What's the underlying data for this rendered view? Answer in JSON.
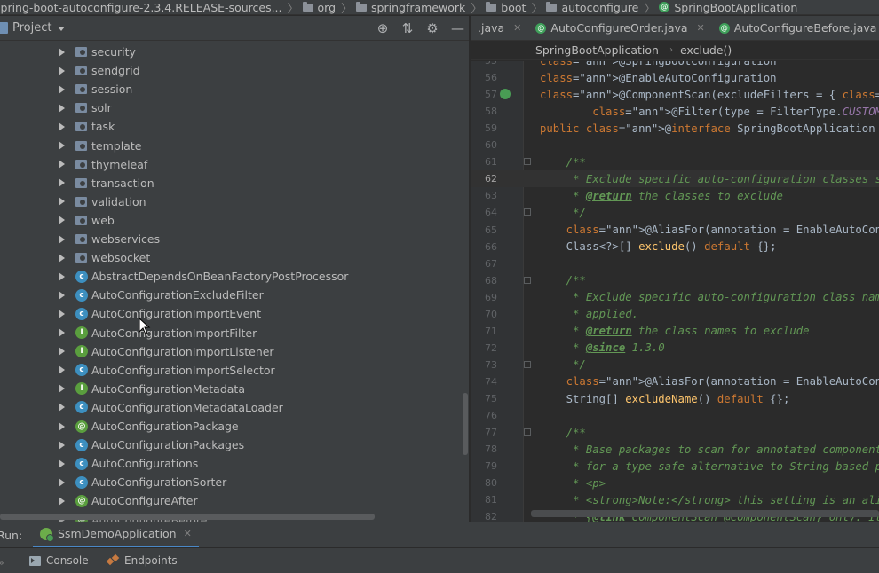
{
  "breadcrumbs": [
    {
      "label": "spring-boot-autoconfigure-2.3.4.RELEASE-sources...",
      "icon": "none"
    },
    {
      "label": "org",
      "icon": "folder-icon"
    },
    {
      "label": "springframework",
      "icon": "folder-icon"
    },
    {
      "label": "boot",
      "icon": "folder-icon"
    },
    {
      "label": "autoconfigure",
      "icon": "folder-icon"
    },
    {
      "label": "SpringBootApplication",
      "icon": "annotation-icon"
    }
  ],
  "project_panel": {
    "title": "Project",
    "tools": [
      "locate-icon",
      "collapse-icon",
      "gear-icon",
      "minimize-icon"
    ],
    "tree": [
      {
        "label": "security",
        "kind": "package",
        "icon": "package-icon"
      },
      {
        "label": "sendgrid",
        "kind": "package",
        "icon": "package-icon"
      },
      {
        "label": "session",
        "kind": "package",
        "icon": "package-icon"
      },
      {
        "label": "solr",
        "kind": "package",
        "icon": "package-icon"
      },
      {
        "label": "task",
        "kind": "package",
        "icon": "package-icon"
      },
      {
        "label": "template",
        "kind": "package",
        "icon": "package-icon"
      },
      {
        "label": "thymeleaf",
        "kind": "package",
        "icon": "package-icon"
      },
      {
        "label": "transaction",
        "kind": "package",
        "icon": "package-icon"
      },
      {
        "label": "validation",
        "kind": "package",
        "icon": "package-icon"
      },
      {
        "label": "web",
        "kind": "package",
        "icon": "package-icon"
      },
      {
        "label": "webservices",
        "kind": "package",
        "icon": "package-icon"
      },
      {
        "label": "websocket",
        "kind": "package",
        "icon": "package-icon"
      },
      {
        "label": "AbstractDependsOnBeanFactoryPostProcessor",
        "kind": "abstract-class",
        "icon": "abstract-class-icon"
      },
      {
        "label": "AutoConfigurationExcludeFilter",
        "kind": "class",
        "icon": "class-icon"
      },
      {
        "label": "AutoConfigurationImportEvent",
        "kind": "class",
        "icon": "class-icon"
      },
      {
        "label": "AutoConfigurationImportFilter",
        "kind": "interface",
        "icon": "interface-icon"
      },
      {
        "label": "AutoConfigurationImportListener",
        "kind": "interface",
        "icon": "interface-icon"
      },
      {
        "label": "AutoConfigurationImportSelector",
        "kind": "class",
        "icon": "class-icon"
      },
      {
        "label": "AutoConfigurationMetadata",
        "kind": "interface",
        "icon": "interface-icon"
      },
      {
        "label": "AutoConfigurationMetadataLoader",
        "kind": "class",
        "icon": "class-icon"
      },
      {
        "label": "AutoConfigurationPackage",
        "kind": "annotation",
        "icon": "annotation-icon"
      },
      {
        "label": "AutoConfigurationPackages",
        "kind": "abstract-class",
        "icon": "abstract-class-icon"
      },
      {
        "label": "AutoConfigurations",
        "kind": "class",
        "icon": "class-icon"
      },
      {
        "label": "AutoConfigurationSorter",
        "kind": "class",
        "icon": "class-icon"
      },
      {
        "label": "AutoConfigureAfter",
        "kind": "annotation",
        "icon": "annotation-icon"
      },
      {
        "label": "AutoConfigureBefore",
        "kind": "annotation",
        "icon": "annotation-icon"
      }
    ]
  },
  "editor": {
    "tabs": [
      {
        "label": ".java",
        "icon": "none"
      },
      {
        "label": "AutoConfigureOrder.java",
        "icon": "annotation-icon"
      },
      {
        "label": "AutoConfigureBefore.java",
        "icon": "annotation-icon"
      }
    ],
    "breadcrumb": [
      "SpringBootApplication",
      "exclude()"
    ],
    "current_line": "62",
    "lines": [
      {
        "n": "55",
        "text": "@SpringBootConfiguration"
      },
      {
        "n": "56",
        "text": "@EnableAutoConfiguration"
      },
      {
        "n": "57",
        "text": "@ComponentScan(excludeFilters = { @Filter(type = FilterType.CUSTOM, classes = TypeExcludeFilter.class),"
      },
      {
        "n": "58",
        "text": "        @Filter(type = FilterType.CUSTOM, classes = AutoConfigurationExcludeFilter.class) })"
      },
      {
        "n": "59",
        "text": "public @interface SpringBootApplication {"
      },
      {
        "n": "60",
        "text": ""
      },
      {
        "n": "61",
        "text": "    /**"
      },
      {
        "n": "62",
        "text": "     * Exclude specific auto-configuration classes such that they will never be applied."
      },
      {
        "n": "63",
        "text": "     * @return the classes to exclude"
      },
      {
        "n": "64",
        "text": "     */"
      },
      {
        "n": "65",
        "text": "    @AliasFor(annotation = EnableAutoConfiguration.class)"
      },
      {
        "n": "66",
        "text": "    Class<?>[] exclude() default {};"
      },
      {
        "n": "67",
        "text": ""
      },
      {
        "n": "68",
        "text": "    /**"
      },
      {
        "n": "69",
        "text": "     * Exclude specific auto-configuration class names such that they will never be"
      },
      {
        "n": "70",
        "text": "     * applied."
      },
      {
        "n": "71",
        "text": "     * @return the class names to exclude"
      },
      {
        "n": "72",
        "text": "     * @since 1.3.0"
      },
      {
        "n": "73",
        "text": "     */"
      },
      {
        "n": "74",
        "text": "    @AliasFor(annotation = EnableAutoConfiguration.class)"
      },
      {
        "n": "75",
        "text": "    String[] excludeName() default {};"
      },
      {
        "n": "76",
        "text": ""
      },
      {
        "n": "77",
        "text": "    /**"
      },
      {
        "n": "78",
        "text": "     * Base packages to scan for annotated components. Use scanBasePackageClasses"
      },
      {
        "n": "79",
        "text": "     * for a type-safe alternative to String-based package names."
      },
      {
        "n": "80",
        "text": "     * <p>"
      },
      {
        "n": "81",
        "text": "     * <strong>Note:</strong> this setting is an alias for"
      },
      {
        "n": "82",
        "text": "     * {@link ComponentScan @ComponentScan} only. It has no effect on @Entity"
      }
    ]
  },
  "run_bar": {
    "label": "Run:",
    "tab": "SsmDemoApplication"
  },
  "bottom_tabs": [
    {
      "label": "Console",
      "icon": "console-icon"
    },
    {
      "label": "Endpoints",
      "icon": "endpoints-icon"
    }
  ],
  "colors": {
    "panel_bg": "#3c3f41",
    "editor_bg": "#2b2b2b",
    "annotation": "#bbb529",
    "keyword": "#cc7832",
    "comment": "#629755"
  }
}
